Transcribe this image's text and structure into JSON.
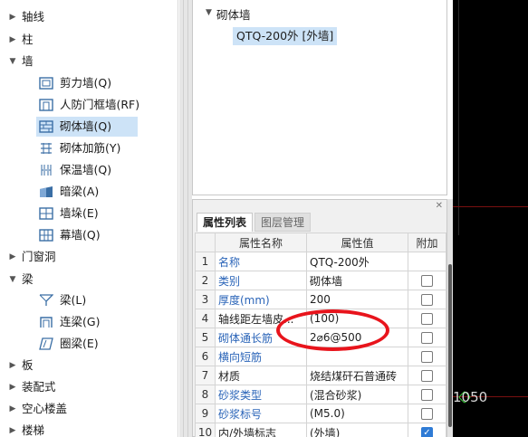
{
  "left_tree": {
    "items": [
      {
        "label": "轴线",
        "expanded": false
      },
      {
        "label": "柱",
        "expanded": false
      },
      {
        "label": "墙",
        "expanded": true
      },
      {
        "label": "剪力墙(Q)",
        "icon": "shear-wall-icon"
      },
      {
        "label": "人防门框墙(RF)",
        "icon": "civil-defense-wall-icon"
      },
      {
        "label": "砌体墙(Q)",
        "icon": "masonry-wall-icon",
        "selected": true
      },
      {
        "label": "砌体加筋(Y)",
        "icon": "masonry-rebar-icon"
      },
      {
        "label": "保温墙(Q)",
        "icon": "insulation-wall-icon"
      },
      {
        "label": "暗梁(A)",
        "icon": "hidden-beam-icon"
      },
      {
        "label": "墙垛(E)",
        "icon": "wall-pier-icon"
      },
      {
        "label": "幕墙(Q)",
        "icon": "curtain-wall-icon"
      },
      {
        "label": "门窗洞",
        "expanded": false
      },
      {
        "label": "梁",
        "expanded": true
      },
      {
        "label": "梁(L)",
        "icon": "beam-icon"
      },
      {
        "label": "连梁(G)",
        "icon": "coupling-beam-icon"
      },
      {
        "label": "圈梁(E)",
        "icon": "ring-beam-icon"
      },
      {
        "label": "板",
        "expanded": false
      },
      {
        "label": "装配式",
        "expanded": false
      },
      {
        "label": "空心楼盖",
        "expanded": false
      },
      {
        "label": "楼梯",
        "expanded": false
      }
    ]
  },
  "component_tree": {
    "group": "砌体墙",
    "selected_item": "QTQ-200外 [外墙]"
  },
  "property_panel": {
    "tabs": [
      {
        "label": "属性列表",
        "active": true
      },
      {
        "label": "图层管理",
        "active": false
      }
    ],
    "columns": {
      "name": "属性名称",
      "value": "属性值",
      "extra": "附加"
    },
    "rows": [
      {
        "num": "1",
        "name": "名称",
        "value": "QTQ-200外",
        "blue": true,
        "checkbox": "none"
      },
      {
        "num": "2",
        "name": "类别",
        "value": "砌体墙",
        "blue": true,
        "checkbox": "unchecked"
      },
      {
        "num": "3",
        "name": "厚度(mm)",
        "value": "200",
        "blue": true,
        "checkbox": "unchecked"
      },
      {
        "num": "4",
        "name": "轴线距左墙皮...",
        "value": "(100)",
        "blue": false,
        "checkbox": "unchecked"
      },
      {
        "num": "5",
        "name": "砌体通长筋",
        "value": "2⌀6@500",
        "blue": true,
        "checkbox": "unchecked"
      },
      {
        "num": "6",
        "name": "横向短筋",
        "value": "",
        "blue": true,
        "checkbox": "unchecked"
      },
      {
        "num": "7",
        "name": "材质",
        "value": "烧结煤矸石普通砖",
        "blue": false,
        "checkbox": "unchecked"
      },
      {
        "num": "8",
        "name": "砂浆类型",
        "value": "(混合砂浆)",
        "blue": true,
        "checkbox": "unchecked"
      },
      {
        "num": "9",
        "name": "砂浆标号",
        "value": "(M5.0)",
        "blue": true,
        "checkbox": "unchecked"
      },
      {
        "num": "10",
        "name": "内/外墙标志",
        "value": "(外墙)",
        "blue": false,
        "checkbox": "checked"
      }
    ],
    "highlight_color": "#e8141c"
  },
  "canvas": {
    "dimension_label": "1050",
    "background": "#000000"
  }
}
